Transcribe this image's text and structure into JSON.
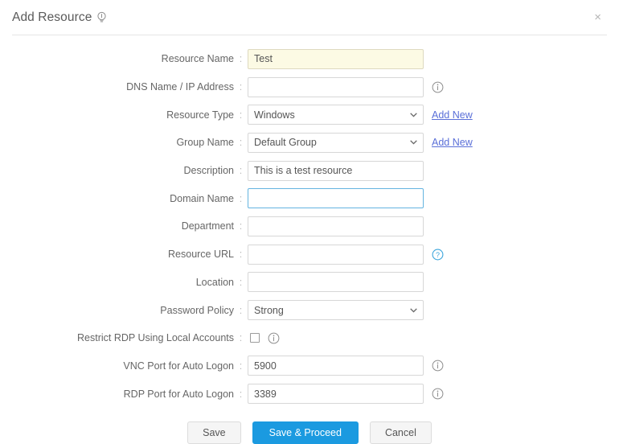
{
  "header": {
    "title": "Add Resource",
    "bulb_icon": "lightbulb-icon",
    "close_label": "×"
  },
  "form": {
    "colon": ":",
    "rows": [
      {
        "label": "Resource Name",
        "type": "text",
        "value": "Test",
        "placeholder": "",
        "style": "autofill",
        "trailing": ""
      },
      {
        "label": "DNS Name / IP Address",
        "type": "text",
        "value": "",
        "placeholder": "",
        "style": "",
        "trailing": "info-icon"
      },
      {
        "label": "Resource Type",
        "type": "select",
        "value": "Windows",
        "options": [
          "Windows"
        ],
        "trailing": "add-new-link",
        "link_label": "Add New"
      },
      {
        "label": "Group Name",
        "type": "select",
        "value": "Default Group",
        "options": [
          "Default Group"
        ],
        "trailing": "add-new-link",
        "link_label": "Add New"
      },
      {
        "label": "Description",
        "type": "text",
        "value": "This is a test resource",
        "placeholder": "",
        "style": "",
        "trailing": ""
      },
      {
        "label": "Domain Name",
        "type": "text",
        "value": "",
        "placeholder": "",
        "style": "focused",
        "trailing": ""
      },
      {
        "label": "Department",
        "type": "text",
        "value": "",
        "placeholder": "",
        "style": "",
        "trailing": ""
      },
      {
        "label": "Resource URL",
        "type": "text",
        "value": "",
        "placeholder": "",
        "style": "",
        "trailing": "help-icon"
      },
      {
        "label": "Location",
        "type": "text",
        "value": "",
        "placeholder": "",
        "style": "",
        "trailing": ""
      },
      {
        "label": "Password Policy",
        "type": "select",
        "value": "Strong",
        "options": [
          "Strong"
        ],
        "trailing": ""
      },
      {
        "label": "Restrict RDP Using Local Accounts",
        "type": "checkbox",
        "checked": false,
        "trailing": "info-icon"
      },
      {
        "label": "VNC Port for Auto Logon",
        "type": "text",
        "value": "5900",
        "placeholder": "",
        "style": "",
        "trailing": "info-icon"
      },
      {
        "label": "RDP Port for Auto Logon",
        "type": "text",
        "value": "3389",
        "placeholder": "",
        "style": "",
        "trailing": "info-icon"
      }
    ]
  },
  "buttons": {
    "save": "Save",
    "save_proceed": "Save & Proceed",
    "cancel": "Cancel"
  },
  "colors": {
    "primary": "#1b9ae0",
    "link": "#5a6fd8",
    "autofill_bg": "#fcfae4",
    "focus_border": "#64b4e0",
    "help_icon": "#3aa5dc"
  }
}
